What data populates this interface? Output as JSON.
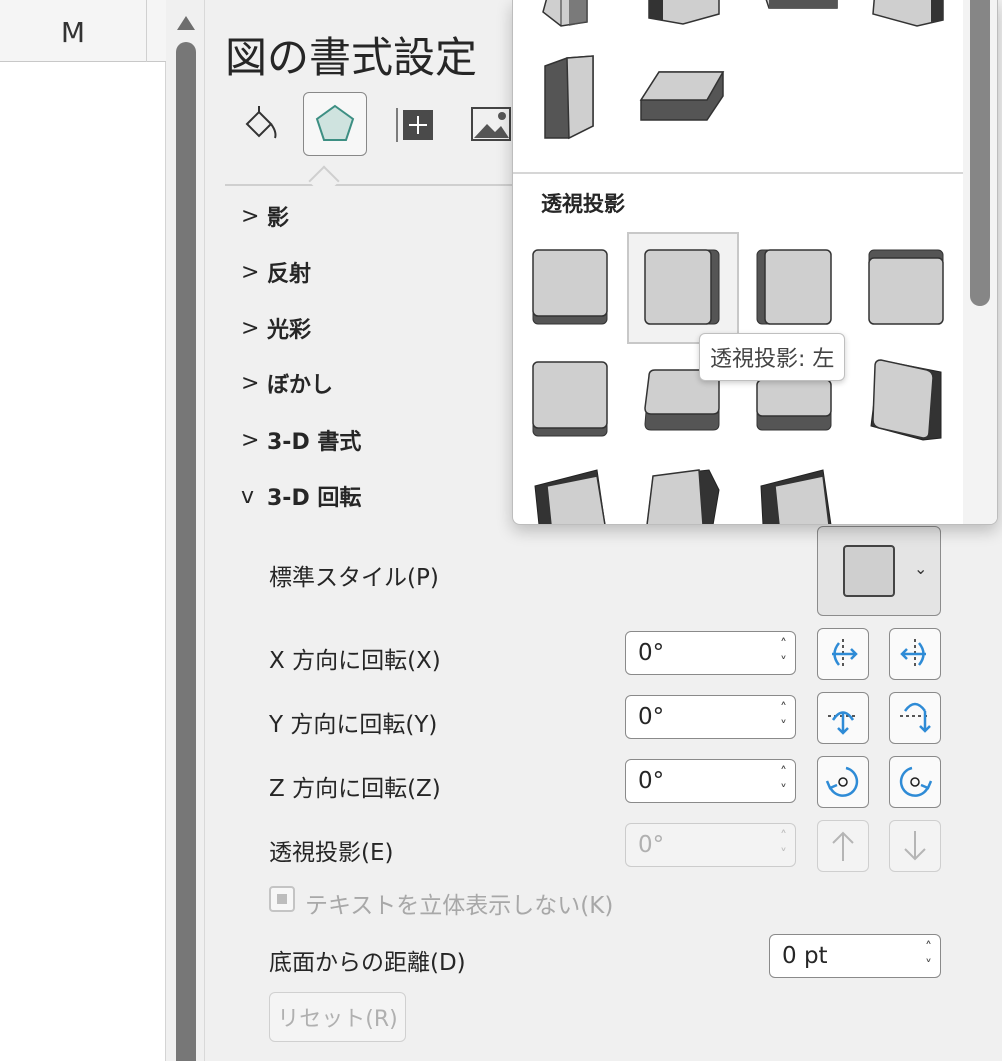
{
  "sheet": {
    "column_label": "M"
  },
  "pane": {
    "title": "図の書式設定",
    "tabs": [
      {
        "name": "fill-line",
        "icon": "paint-bucket-icon"
      },
      {
        "name": "effects",
        "icon": "pentagon-icon",
        "selected": true
      },
      {
        "name": "size-properties",
        "icon": "size-position-icon"
      },
      {
        "name": "picture",
        "icon": "picture-icon"
      }
    ],
    "sections": [
      {
        "label": "影",
        "chevron": ">"
      },
      {
        "label": "反射",
        "chevron": ">"
      },
      {
        "label": "光彩",
        "chevron": ">"
      },
      {
        "label": "ぼかし",
        "chevron": ">"
      },
      {
        "label": "3-D 書式",
        "chevron": ">"
      },
      {
        "label": "3-D 回転",
        "chevron": "v"
      }
    ],
    "rotation": {
      "preset_label": "標準スタイル(P)",
      "x_label": "X 方向に回転(X)",
      "x_value": "0°",
      "y_label": "Y 方向に回転(Y)",
      "y_value": "0°",
      "z_label": "Z 方向に回転(Z)",
      "z_value": "0°",
      "perspective_label": "透視投影(E)",
      "perspective_value": "0°",
      "keep_text_flat_label": "テキストを立体表示しない(K)",
      "distance_label": "底面からの距離(D)",
      "distance_value": "0 pt",
      "reset_label": "リセット(R)"
    }
  },
  "gallery": {
    "section_title": "透視投影",
    "tooltip": "透視投影: 左",
    "accent_color": "#2e8bd6"
  }
}
